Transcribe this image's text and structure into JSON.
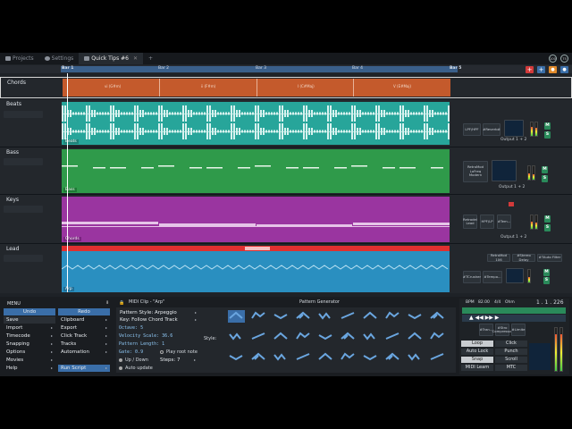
{
  "tabs": [
    {
      "label": "Projects",
      "icon": "folder-icon"
    },
    {
      "label": "Settings",
      "icon": "gear-icon"
    },
    {
      "label": "Quick Tips #6",
      "icon": "edit-icon"
    }
  ],
  "tab_add": "+",
  "top_right": {
    "a": "100",
    "b": "75"
  },
  "ruler": {
    "bar1": "Bar 1",
    "bar2": "Bar 2",
    "bar3": "Bar 3",
    "bar4": "Bar 4",
    "bar5": "Bar 5"
  },
  "header_buttons": {
    "add_red": "+",
    "add": "+",
    "c": "●",
    "d": "●"
  },
  "tracks": [
    {
      "name": "Chords",
      "color": "#c45a2c"
    },
    {
      "name": "Beats",
      "color": "#27a59a"
    },
    {
      "name": "Bass",
      "color": "#2f9a4a"
    },
    {
      "name": "Keys",
      "color": "#9a35a0"
    },
    {
      "name": "Lead",
      "color": "#2a8fc0"
    }
  ],
  "chords": [
    "vi (G#m)",
    "ii (F#m)",
    "I (C#Maj)",
    "V (E#Maj)"
  ],
  "clip_labels": {
    "beats": "Beats",
    "bass": "Bass",
    "keys": "Chords",
    "lead": "Arp"
  },
  "plugins": {
    "beats": [
      "LPF/HPF",
      "#Reverb#",
      "Output 1 + 2"
    ],
    "bass": [
      "RetroMod LoFreq Modern",
      "Output 1 + 2"
    ],
    "keys": [
      "Retrodel Lead",
      "HPF/LP",
      "#Tem...",
      "Output 1 + 2"
    ],
    "lead": [
      "RetroMod 106",
      "#Stereo Delay",
      "#TAuto Filter",
      "#TCrusher",
      "#Tempo..."
    ]
  },
  "menu": {
    "title": "MENU",
    "undo": "Undo",
    "redo": "Redo",
    "left": [
      "Save",
      "Import",
      "Timecode",
      "Snapping",
      "Options",
      "Movies",
      "Help"
    ],
    "right": [
      "Clipboard",
      "Export",
      "Click Track",
      "Tracks",
      "Automation",
      "Run Script"
    ]
  },
  "midi": {
    "title": "MIDI Clip - \"Arp\"",
    "generator": "Pattern Generator",
    "pattern_style": "Pattern Style: Arpeggio",
    "key": "Key: Follow Chord Track",
    "octave": "Octave: 5",
    "velocity": "Velocity Scale: 36.6",
    "length": "Pattern Length: 1",
    "gate": "Gate: 0.9",
    "play_root": "Play root note",
    "direction": "Up / Down",
    "steps": "Steps: 7",
    "auto_update": "Auto update",
    "style_label": "Style:"
  },
  "transport": {
    "bpm_label": "BPM",
    "bpm": "82.00",
    "sig": "4/4",
    "sig2": "Ohm",
    "pos": "1 . 1 . 226",
    "plugins": [
      "#Tran...",
      "#Stro Compressor",
      "#Limite"
    ],
    "buttons": [
      "Loop",
      "Click",
      "Auto Lock",
      "Punch",
      "Snap",
      "Scroll",
      "MIDI Learn",
      "MTC"
    ]
  }
}
